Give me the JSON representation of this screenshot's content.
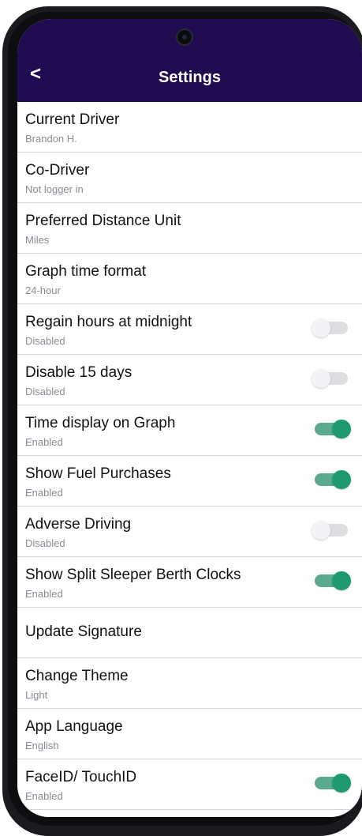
{
  "header": {
    "title": "Settings",
    "back_label": "<"
  },
  "colors": {
    "header_bg": "#1f0b4f",
    "toggle_on": "#1d9b6e",
    "toggle_off": "#dedee2"
  },
  "settings": [
    {
      "label": "Current Driver",
      "value": "Brandon H.",
      "toggle": null
    },
    {
      "label": "Co-Driver",
      "value": "Not logger in",
      "toggle": null
    },
    {
      "label": "Preferred Distance Unit",
      "value": "Miles",
      "toggle": null
    },
    {
      "label": "Graph time format",
      "value": "24-hour",
      "toggle": null
    },
    {
      "label": "Regain hours at midnight",
      "value": "Disabled",
      "toggle": false
    },
    {
      "label": "Disable 15 days",
      "value": "Disabled",
      "toggle": false
    },
    {
      "label": "Time display on Graph",
      "value": "Enabled",
      "toggle": true
    },
    {
      "label": "Show Fuel Purchases",
      "value": "Enabled",
      "toggle": true
    },
    {
      "label": "Adverse Driving",
      "value": "Disabled",
      "toggle": false
    },
    {
      "label": "Show Split Sleeper Berth Clocks",
      "value": "Enabled",
      "toggle": true
    },
    {
      "label": "Update Signature",
      "value": null,
      "toggle": null
    },
    {
      "label": "Change Theme",
      "value": "Light",
      "toggle": null
    },
    {
      "label": "App Language",
      "value": "English",
      "toggle": null
    },
    {
      "label": "FaceID/ TouchID",
      "value": "Enabled",
      "toggle": true
    }
  ]
}
